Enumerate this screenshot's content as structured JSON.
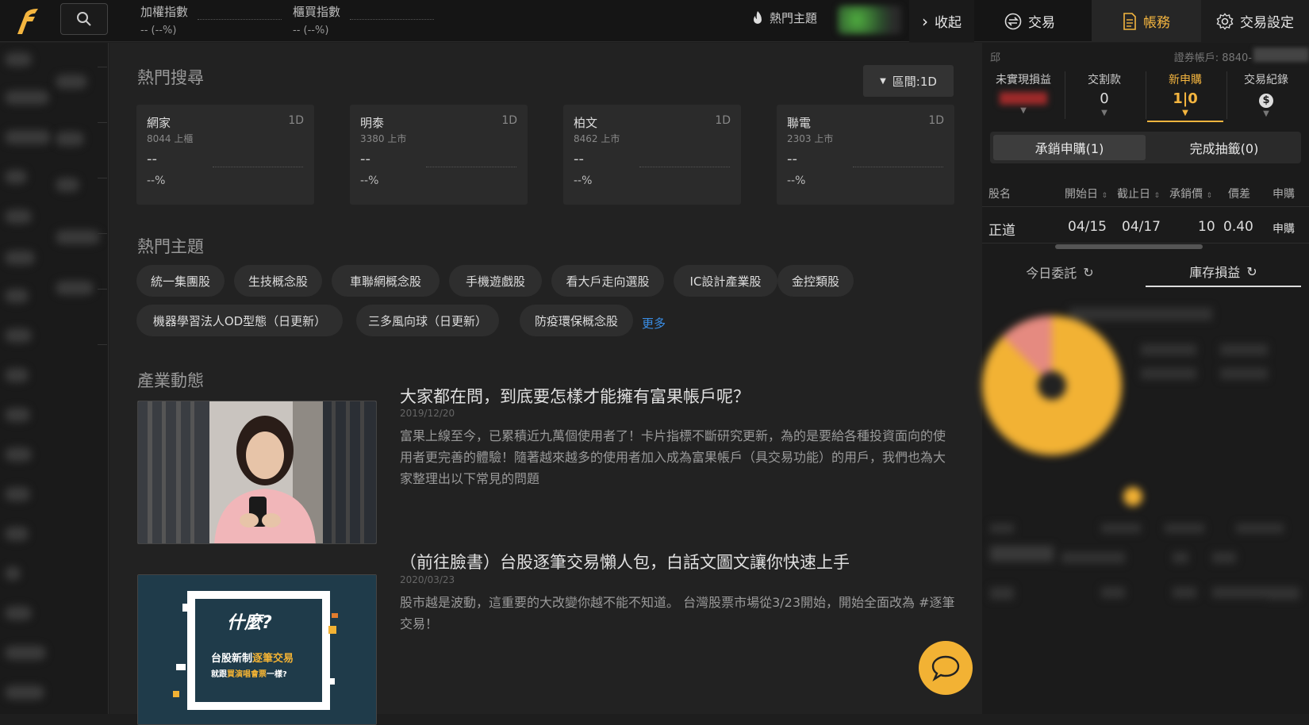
{
  "topbar": {
    "index1_name": "加權指數",
    "index1_value": "-- (--%)",
    "index2_name": "櫃買指數",
    "index2_value": "-- (--%)",
    "hot_topics": "熱門主題",
    "collapse": "收起",
    "trade": "交易",
    "account": "帳務",
    "trade_settings": "交易設定"
  },
  "main": {
    "hot_search_title": "熱門搜尋",
    "range_label": "區間:1D",
    "cards": [
      {
        "name": "網家",
        "period": "1D",
        "code": "8044 上櫃",
        "price": "--",
        "pct": "--%"
      },
      {
        "name": "明泰",
        "period": "1D",
        "code": "3380 上市",
        "price": "--",
        "pct": "--%"
      },
      {
        "name": "柏文",
        "period": "1D",
        "code": "8462 上市",
        "price": "--",
        "pct": "--%"
      },
      {
        "name": "聯電",
        "period": "1D",
        "code": "2303 上市",
        "price": "--",
        "pct": "--%"
      }
    ],
    "hot_theme_title": "熱門主題",
    "tags": [
      "統一集團股",
      "生技概念股",
      "車聯網概念股",
      "手機遊戲股",
      "看大戶走向選股",
      "IC設計產業股",
      "金控類股",
      "機器學習法人OD型態（日更新）",
      "三多風向球（日更新）",
      "防疫環保概念股"
    ],
    "more": "更多",
    "industry_title": "產業動態",
    "articles": [
      {
        "title": "大家都在問，到底要怎樣才能擁有富果帳戶呢？",
        "date": "2019/12/20",
        "body": "富果上線至今，已累積近九萬個使用者了！卡片指標不斷研究更新，為的是要給各種投資面向的使用者更完善的體驗！隨著越來越多的使用者加入成為富果帳戶（具交易功能）的用戶，我們也為大家整理出以下常見的問題"
      },
      {
        "title": "（前往臉書）台股逐筆交易懶人包，白話文圖文讓你快速上手",
        "date": "2020/03/23",
        "body": "股市越是波動，這重要的大改變你越不能不知道。 台灣股票市場從3/23開始，開始全面改為 #逐筆交易！"
      }
    ],
    "promo": {
      "line1": "什麼?",
      "line2a": "台股新制",
      "line2b": "逐筆交易",
      "line3a": "就跟",
      "line3b": "買演唱會票",
      "line3c": "一樣?"
    }
  },
  "right": {
    "user_label": "邱",
    "account_label": "證券帳戶: 8840-",
    "tabs": [
      {
        "label": "未實現損益",
        "value": ""
      },
      {
        "label": "交割款",
        "value": "0"
      },
      {
        "label": "新申購",
        "value": "1|0"
      },
      {
        "label": "交易紀錄",
        "value": "$"
      }
    ],
    "seg_on": "承銷申購(1)",
    "seg_off": "完成抽籤(0)",
    "table_headers": [
      "股名",
      "開始日",
      "截止日",
      "承銷價",
      "價差",
      "申購"
    ],
    "row": {
      "name": "正道",
      "start": "04/15",
      "end": "04/17",
      "price": "10",
      "diff": "0.40",
      "action": "申購"
    },
    "bottom_tab1": "今日委託",
    "bottom_tab2": "庫存損益"
  },
  "colors": {
    "accent": "#f4b53f",
    "link": "#3a8fe8",
    "pie_main": "#f2b234",
    "pie_slice": "#e58a80"
  }
}
